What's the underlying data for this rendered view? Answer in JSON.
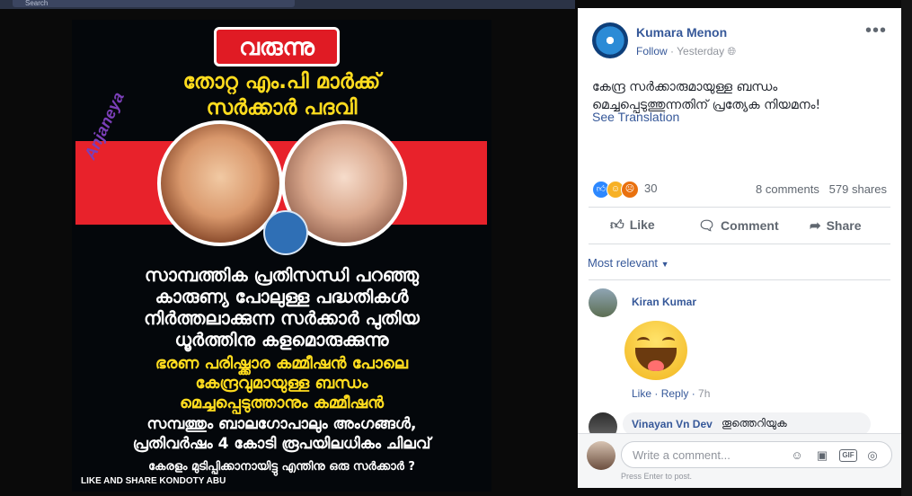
{
  "topbar": {
    "search_label": "Search"
  },
  "image": {
    "badge": "വരുന്നു",
    "headline_1": "തോറ്റ എം.പി മാർക്ക്",
    "headline_2": "സർക്കാർ പദവി",
    "watermark": "Anjaneya",
    "para1": [
      "സാമ്പത്തിക പ്രതിസന്ധി പറഞ്ഞു",
      "കാരുണ്യ പോലുള്ള പദ്ധതികൾ",
      "നിർത്തലാക്കുന്ന സർക്കാർ പുതിയ",
      "ധൂർത്തിനു കളമൊരുക്കുന്നു"
    ],
    "para2": [
      "ഭരണ പരിഷ്ക്കാര കമ്മീഷൻ പോലെ",
      "കേന്ദ്രവുമായുള്ള ബന്ധം",
      "മെച്ചപ്പെടുത്താനും കമ്മീഷൻ"
    ],
    "para3": [
      "സമ്പത്തും ബാലഗോപാലും അംഗങ്ങൾ,",
      "പ്രതിവർഷം 4 കോടി രൂപയിലധികം ചിലവ്"
    ],
    "para4": "കേരളം മുടിപ്പിക്കാനായിട്ടു എന്തിനു ഒരു സർക്കാർ ?",
    "share_line": "LIKE AND SHARE KONDOTY ABU"
  },
  "post": {
    "author": "Kumara Menon",
    "follow": "Follow",
    "time": "Yesterday",
    "text": "കേന്ദ്ര സർക്കാരുമായുള്ള ബന്ധം മെച്ചപ്പെടുത്തുന്നതിന് പ്രത്യേക നിയമനം!",
    "see_translation": "See Translation",
    "reaction_count": "30",
    "comments_count": "8 comments",
    "shares_count": "579 shares",
    "actions": {
      "like": "Like",
      "comment": "Comment",
      "share": "Share"
    }
  },
  "comments": {
    "sort_label": "Most relevant",
    "items": [
      {
        "name": "Kiran Kumar",
        "like": "Like",
        "reply": "Reply",
        "time": "7h"
      },
      {
        "name": "Vinayan Vn Dev",
        "text": "തൂത്തെറിയുക"
      }
    ],
    "composer_placeholder": "Write a comment...",
    "press_enter": "Press Enter to post."
  },
  "colors": {
    "link": "#365899",
    "badge_red": "#e01b24",
    "headline_yellow": "#ffdc1e"
  }
}
